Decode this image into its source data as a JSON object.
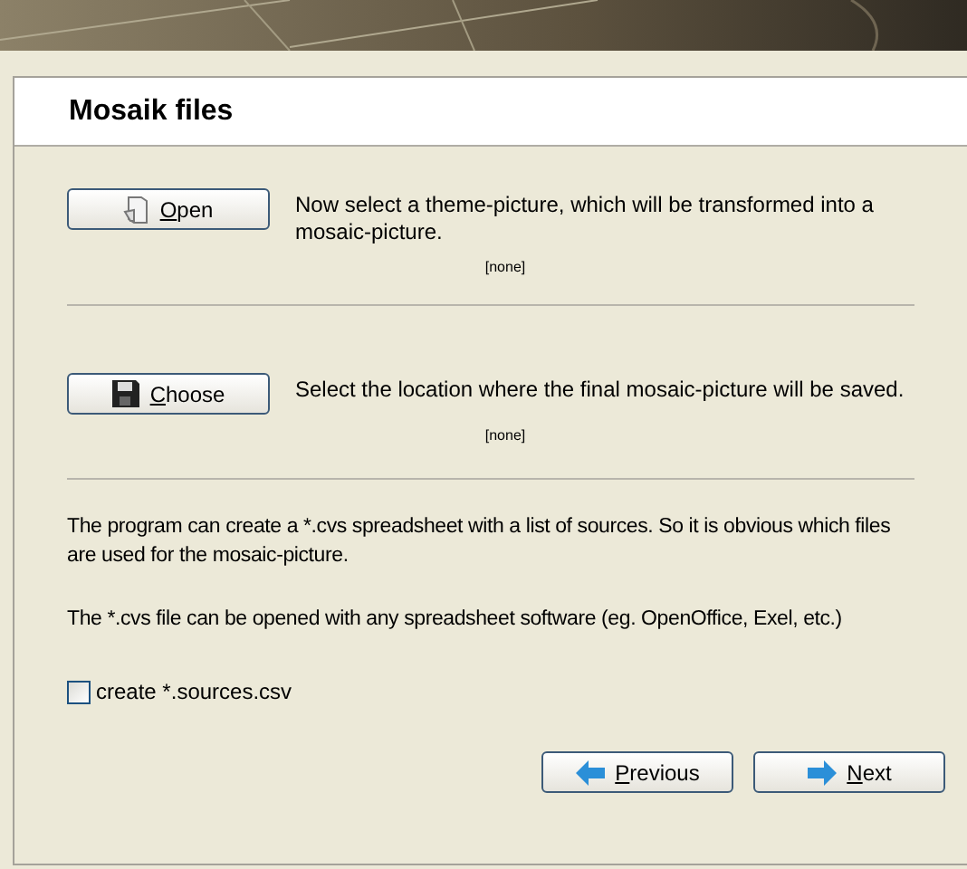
{
  "header": {
    "title": "Mosaik files"
  },
  "sections": [
    {
      "button": "Open",
      "kind": "open",
      "description": "Now select a theme-picture, which will be transformed into a mosaic-picture.",
      "value": "[none]"
    },
    {
      "button": "Choose",
      "kind": "save",
      "description": "Select the location where the final mosaic-picture will be saved.",
      "value": "[none]"
    }
  ],
  "info": [
    "The program can create a *.cvs spreadsheet with a list of sources. So it is obvious which files are used for the mosaic-picture.",
    "The *.cvs file can be opened with any spreadsheet software (eg. OpenOffice, Exel, etc.)"
  ],
  "checkbox": {
    "label": "create *.sources.csv",
    "checked": false
  },
  "buttons": [
    {
      "label": "Previous",
      "kind": "left"
    },
    {
      "label": "Next",
      "kind": "right"
    }
  ]
}
